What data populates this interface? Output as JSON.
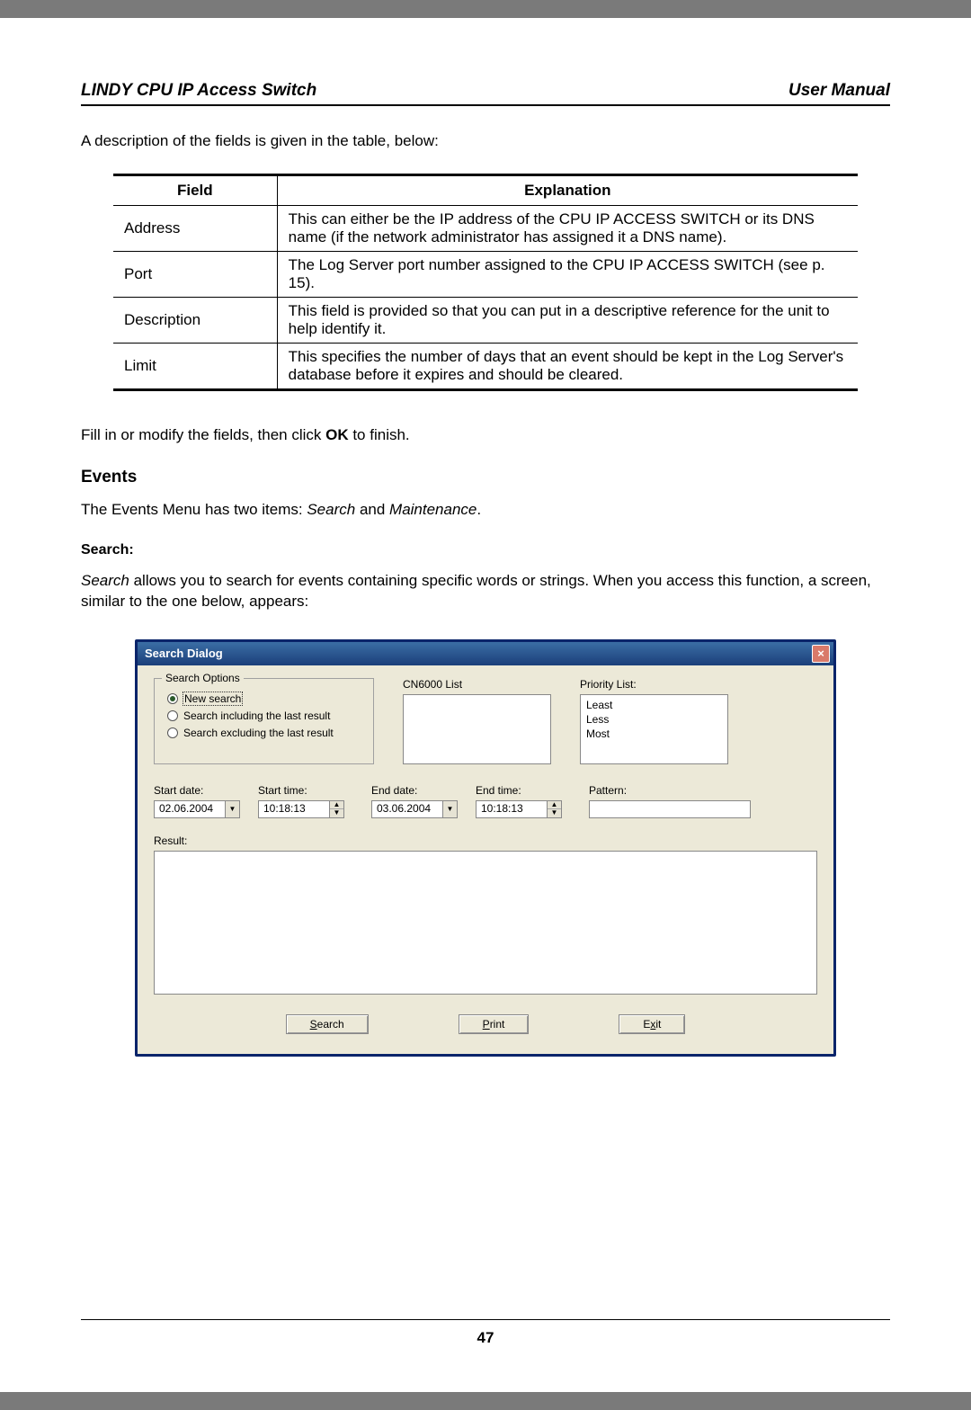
{
  "header": {
    "left": "LINDY CPU IP Access Switch",
    "right": "User Manual"
  },
  "intro": "A description of the fields is given in the table, below:",
  "table": {
    "col_field": "Field",
    "col_expl": "Explanation",
    "rows": [
      {
        "field": "Address",
        "expl": "This can either be the IP address of the CPU IP ACCESS SWITCH or its DNS name (if the network administrator has assigned it a DNS name)."
      },
      {
        "field": "Port",
        "expl": "The Log Server port number assigned to the CPU IP ACCESS SWITCH (see p. 15)."
      },
      {
        "field": "Description",
        "expl": "This field is provided so that you can put in a descriptive reference for the unit to help identify it."
      },
      {
        "field": "Limit",
        "expl": "This specifies the number of days that an event should be kept in the Log Server's database before it expires and should be cleared."
      }
    ]
  },
  "fill_line_pre": "Fill in or modify the fields, then click ",
  "fill_line_bold": "OK",
  "fill_line_post": " to finish.",
  "events_heading": "Events",
  "events_line_pre": "The Events Menu has two items: ",
  "events_line_i1": "Search",
  "events_line_mid": " and ",
  "events_line_i2": "Maintenance",
  "events_line_post": ".",
  "search_heading": "Search:",
  "search_para_i": "Search",
  "search_para_rest": " allows you to search for events containing specific words or strings. When you access this function, a screen, similar to the one below, appears:",
  "dialog": {
    "title": "Search Dialog",
    "close": "×",
    "fieldset_legend": "Search Options",
    "radio1": "New search",
    "radio2": "Search including the last result",
    "radio3": "Search excluding the last result",
    "cn_label": "CN6000 List",
    "priority_label": "Priority List:",
    "priority_items": [
      "Least",
      "Less",
      "Most"
    ],
    "start_date_label": "Start date:",
    "start_time_label": "Start time:",
    "end_date_label": "End date:",
    "end_time_label": "End time:",
    "pattern_label": "Pattern:",
    "start_date": "02.06.2004",
    "start_time": "10:18:13",
    "end_date": "03.06.2004",
    "end_time": "10:18:13",
    "result_label": "Result:",
    "btn_search": "Search",
    "btn_print": "Print",
    "btn_exit": "Exit"
  },
  "page_number": "47"
}
